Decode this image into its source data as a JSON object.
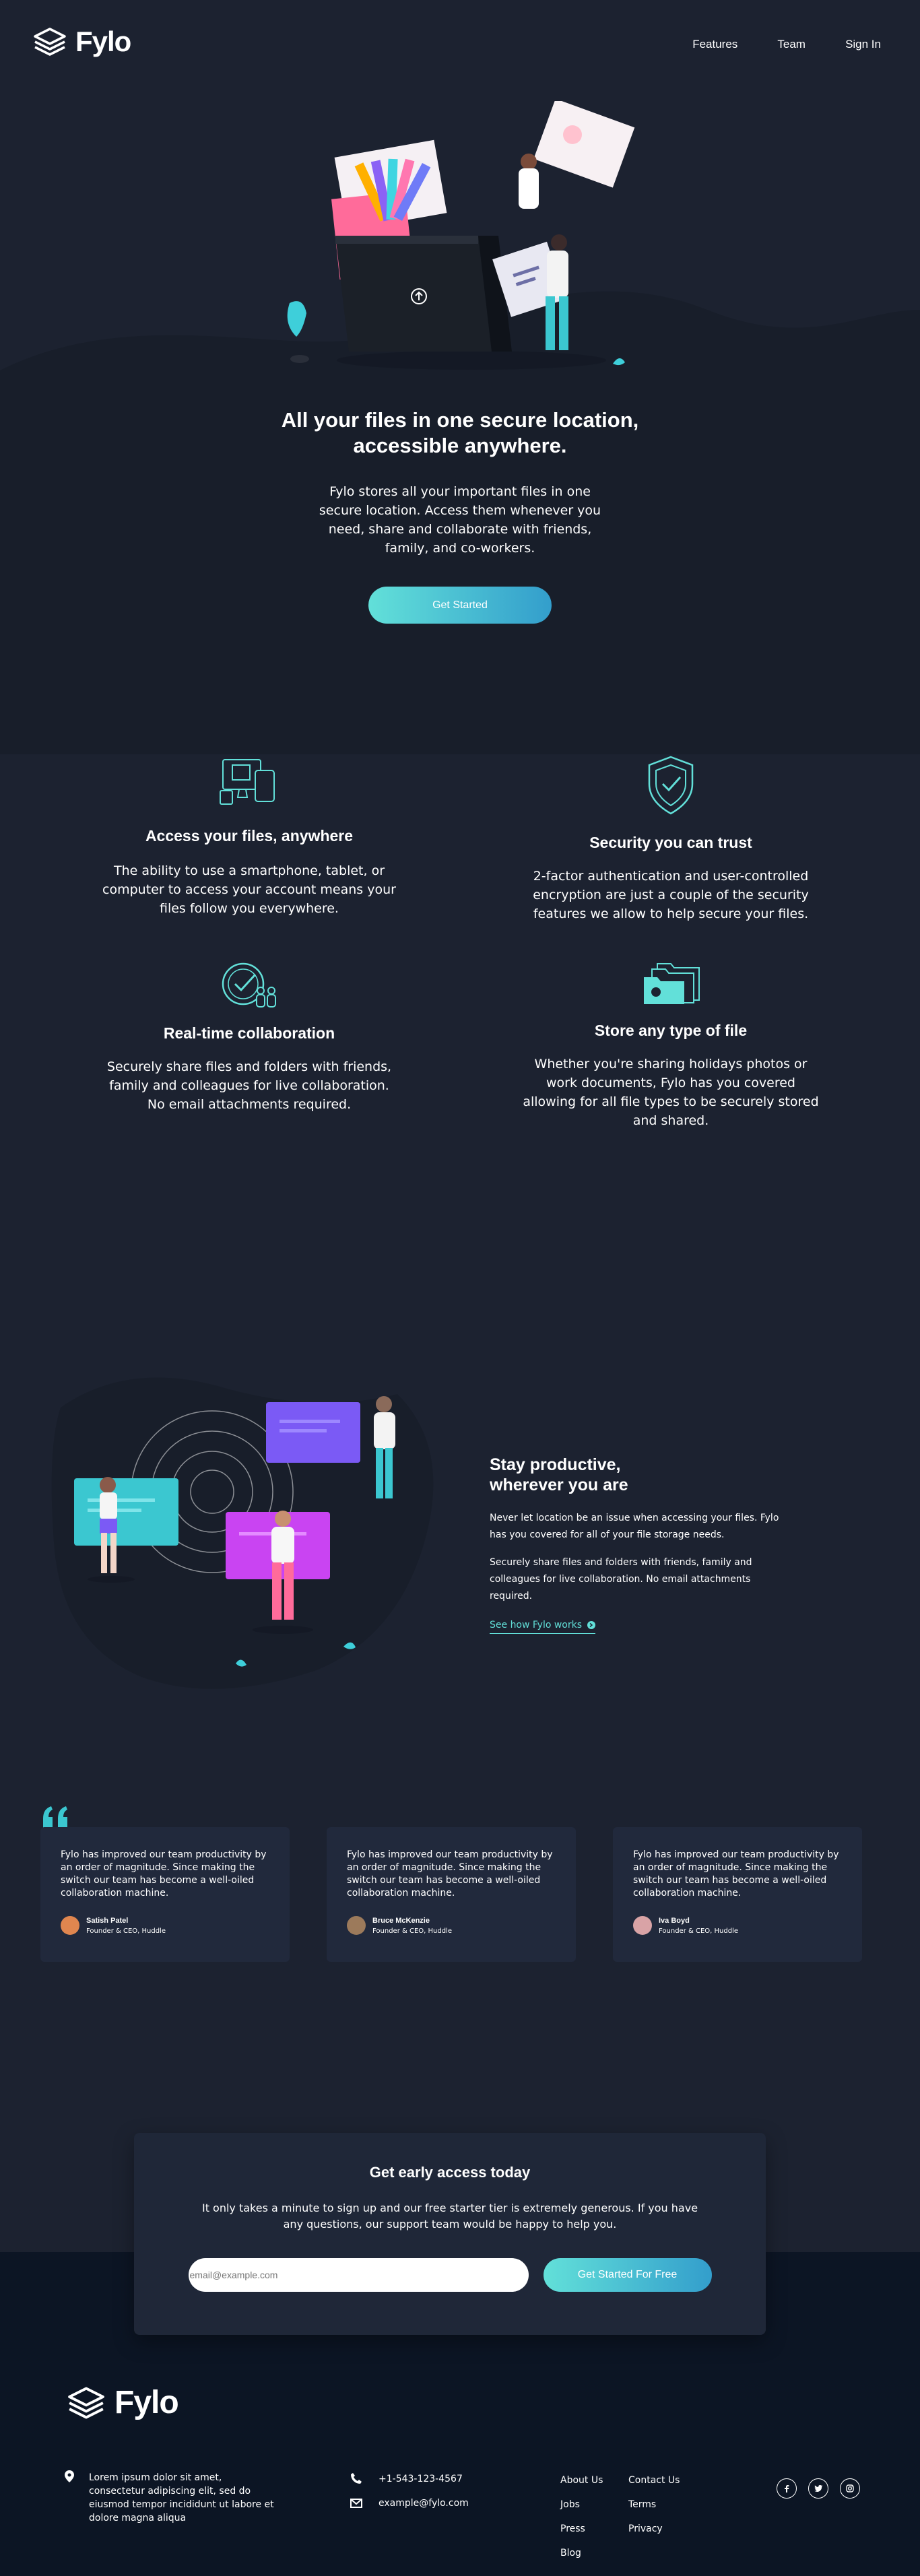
{
  "header": {
    "logo_text": "Fylo",
    "nav": [
      "Features",
      "Team",
      "Sign In"
    ]
  },
  "hero": {
    "title": "All your files in one secure location, accessible anywhere.",
    "text": "Fylo stores all your important files in one secure location. Access them whenever you need, share and collaborate with friends, family, and co-workers.",
    "cta": "Get Started"
  },
  "features": [
    {
      "icon": "devices-icon",
      "title": "Access your files, anywhere",
      "text": "The ability to use a smartphone, tablet, or computer to access your account means your files follow you everywhere."
    },
    {
      "icon": "shield-icon",
      "title": "Security you can trust",
      "text": "2-factor authentication and user-controlled encryption are just a couple of the security features we allow to help secure your files."
    },
    {
      "icon": "collaboration-icon",
      "title": "Real-time collaboration",
      "text": "Securely share files and folders with friends, family and colleagues for live collaboration. No email attachments required."
    },
    {
      "icon": "folders-icon",
      "title": "Store any type of file",
      "text": "Whether you're sharing holidays photos or work documents, Fylo has you covered allowing for all file types to be securely stored and shared."
    }
  ],
  "productive": {
    "title": "Stay productive, wherever you are",
    "para1": "Never let location be an issue when accessing your files. Fylo has you covered for all of your file storage needs.",
    "para2": "Securely share files and folders with friends, family and colleagues for live collaboration. No email attachments required.",
    "link": "See how Fylo works"
  },
  "testimonials": [
    {
      "text": "Fylo has improved our team productivity by an order of magnitude. Since making the switch our team has become a well-oiled collaboration machine.",
      "name": "Satish Patel",
      "role": "Founder & CEO, Huddle",
      "avatar_color": "#e0864f"
    },
    {
      "text": "Fylo has improved our team productivity by an order of magnitude. Since making the switch our team has become a well-oiled collaboration machine.",
      "name": "Bruce McKenzie",
      "role": "Founder & CEO, Huddle",
      "avatar_color": "#9c7a5b"
    },
    {
      "text": "Fylo has improved our team productivity by an order of magnitude. Since making the switch our team has become a well-oiled collaboration machine.",
      "name": "Iva Boyd",
      "role": "Founder & CEO, Huddle",
      "avatar_color": "#d9a3a6"
    }
  ],
  "access": {
    "title": "Get early access today",
    "text": "It only takes a minute to sign up and our free starter tier is extremely generous. If you have any questions, our support team would be happy to help you.",
    "email_placeholder": "email@example.com",
    "cta": "Get Started For Free"
  },
  "footer": {
    "logo_text": "Fylo",
    "address": "Lorem ipsum dolor sit amet, consectetur adipiscing elit, sed do eiusmod tempor incididunt ut labore et dolore magna aliqua",
    "phone": "+1-543-123-4567",
    "email": "example@fylo.com",
    "links_col1": [
      "About Us",
      "Jobs",
      "Press",
      "Blog"
    ],
    "links_col2": [
      "Contact Us",
      "Terms",
      "Privacy"
    ]
  },
  "colors": {
    "bg_main": "#1c2230",
    "bg_intro": "#181e2a",
    "bg_footer": "#0c1524",
    "accent_cyan": "#62e0d9",
    "accent_blue": "#339ecc",
    "card": "#21293c"
  }
}
